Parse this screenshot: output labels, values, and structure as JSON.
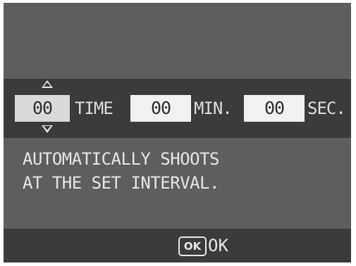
{
  "interval": {
    "hours_value": "00",
    "hours_unit": "TIME",
    "minutes_value": "00",
    "minutes_unit": "MIN.",
    "seconds_value": "00",
    "seconds_unit": "SEC."
  },
  "message": {
    "line1": "AUTOMATICALLY SHOOTS",
    "line2": "AT THE SET INTERVAL."
  },
  "footer": {
    "ok_icon_text": "OK",
    "ok_label": "OK"
  },
  "icons": {
    "increment": "up-arrow-icon",
    "decrement": "down-arrow-icon",
    "ok": "ok-button-icon"
  }
}
